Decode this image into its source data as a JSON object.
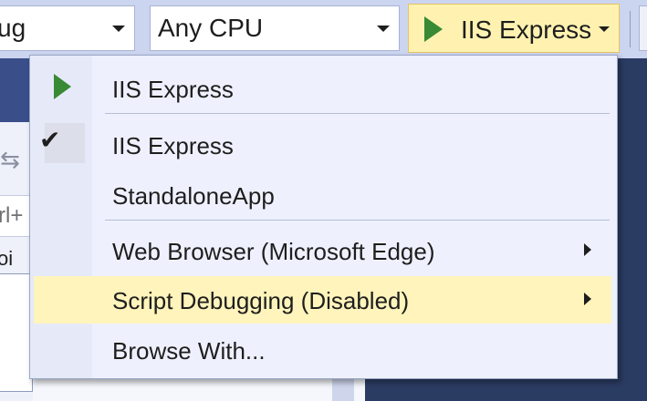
{
  "toolbar": {
    "config_combo": {
      "value": "ug"
    },
    "platform_combo": {
      "value": "Any CPU"
    },
    "run_button": {
      "label": "IIS Express"
    }
  },
  "background": {
    "input_fragment": "rl+",
    "box_fragment": "oi"
  },
  "menu": {
    "items": [
      {
        "label": "IIS Express",
        "icon": "play-icon"
      },
      {
        "label": "IIS Express",
        "icon": "checkmark-icon",
        "checked": true,
        "check_glyph": "✔"
      },
      {
        "label": "StandaloneApp"
      },
      {
        "label": "Web Browser (Microsoft Edge)",
        "submenu": true
      },
      {
        "label": "Script Debugging (Disabled)",
        "submenu": true,
        "highlighted": true
      },
      {
        "label": "Browse With..."
      }
    ]
  },
  "colors": {
    "accent_play": "#388a34",
    "highlight": "#fff4bb",
    "run_button_bg": "#fff2b0"
  }
}
